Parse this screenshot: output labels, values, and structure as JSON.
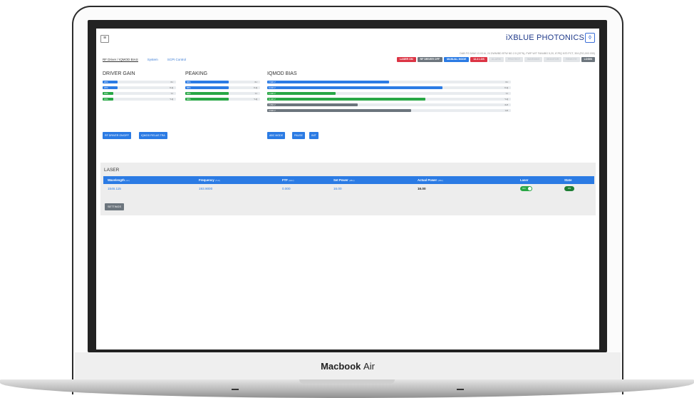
{
  "device": {
    "brand": "Macbook",
    "model": "Air"
  },
  "app": {
    "menu_icon": "hamburger-icon",
    "logo_text": "iXBLUE PHOTONICS",
    "status_line": "DAB FG DAW 13.03 Ai, 24 DWM/BD BTW ND 2.5 (20°N), FWP W/T FAN4BG 5,20, 6°/RQ N70 PCT, 304 (RG,003 030)",
    "tabs": [
      {
        "label": "RF Driver / IQMOD BIAS",
        "active": true
      },
      {
        "label": "System",
        "active": false
      },
      {
        "label": "SCPI Control",
        "active": false
      }
    ],
    "badges": [
      {
        "label": "LASER ON",
        "color": "#dc3545"
      },
      {
        "label": "RF DRIVER OFF",
        "color": "#6c757d"
      },
      {
        "label": "MANUAL MODE",
        "color": "#2b7be4"
      },
      {
        "label": "12.4 LOS",
        "color": "#dc3545"
      },
      {
        "label": "ALARM",
        "color": "#e2e5e8"
      },
      {
        "label": "PROTECT",
        "color": "#e2e5e8"
      },
      {
        "label": "WARNING",
        "color": "#e2e5e8"
      },
      {
        "label": "MONITOR",
        "color": "#e2e5e8"
      },
      {
        "label": "REMOTE",
        "color": "#e2e5e8"
      },
      {
        "label": "LOGIN",
        "color": "#6c757d"
      }
    ],
    "driver_gain": {
      "title": "DRIVER GAIN",
      "gauges": [
        {
          "label": "20%",
          "channel": "X-I",
          "level": 0.2,
          "color": "#2b7be4"
        },
        {
          "label": "20%",
          "channel": "X-Q",
          "level": 0.2,
          "color": "#2b7be4"
        },
        {
          "label": "15%",
          "channel": "Y-I",
          "level": 0.15,
          "color": "#28a745"
        },
        {
          "label": "15%",
          "channel": "Y-Q",
          "level": 0.15,
          "color": "#28a745"
        }
      ]
    },
    "peaking": {
      "title": "PEAKING",
      "gauges": [
        {
          "label": "58%",
          "channel": "X-I",
          "level": 0.58,
          "color": "#2b7be4"
        },
        {
          "label": "58%",
          "channel": "X-Q",
          "level": 0.58,
          "color": "#2b7be4"
        },
        {
          "label": "58%",
          "channel": "Y-I",
          "level": 0.58,
          "color": "#28a745"
        },
        {
          "label": "58%",
          "channel": "Y-Q",
          "level": 0.58,
          "color": "#28a745"
        }
      ]
    },
    "iqmod_bias": {
      "title": "IQMOD BIAS",
      "gauges": [
        {
          "label": "7.900 V",
          "channel": "X-I",
          "level": 0.5,
          "color": "#2b7be4"
        },
        {
          "label": "9.000 V",
          "channel": "X-Q",
          "level": 0.72,
          "color": "#2b7be4"
        },
        {
          "label": "1.000 V",
          "channel": "Y-I",
          "level": 0.28,
          "color": "#28a745"
        },
        {
          "label": "8.100 V",
          "channel": "Y-Q",
          "level": 0.65,
          "color": "#28a745"
        },
        {
          "label": "7.050 V",
          "channel": "X-P",
          "level": 0.37,
          "color": "#6c757d"
        },
        {
          "label": "4.500 V",
          "channel": "Y-P",
          "level": 0.59,
          "color": "#6c757d"
        }
      ]
    },
    "buttons_left": [
      "RF DRIVER ON/OFF",
      "IQMOD FIELAS TRA"
    ],
    "buttons_right": [
      "ABC MODE",
      "PAUSE",
      "INIT"
    ]
  },
  "laser": {
    "title": "LASER",
    "columns": [
      {
        "label": "Wavelength",
        "unit": "(nm)"
      },
      {
        "label": "Frequency",
        "unit": "(THz)"
      },
      {
        "label": "FTF",
        "unit": "(GHz)"
      },
      {
        "label": "Set Power",
        "unit": "(dBm)"
      },
      {
        "label": "Actual Power",
        "unit": "(dBm)"
      },
      {
        "label": "Laser",
        "unit": ""
      },
      {
        "label": "State",
        "unit": ""
      }
    ],
    "row": {
      "wavelength": "1546.115",
      "frequency": "193.9000",
      "ftf": "0.000",
      "set_power": "16.00",
      "actual_power": "16.00",
      "laser_toggle": "ON",
      "state": "ON"
    },
    "settings_label": "SETTINGS"
  }
}
